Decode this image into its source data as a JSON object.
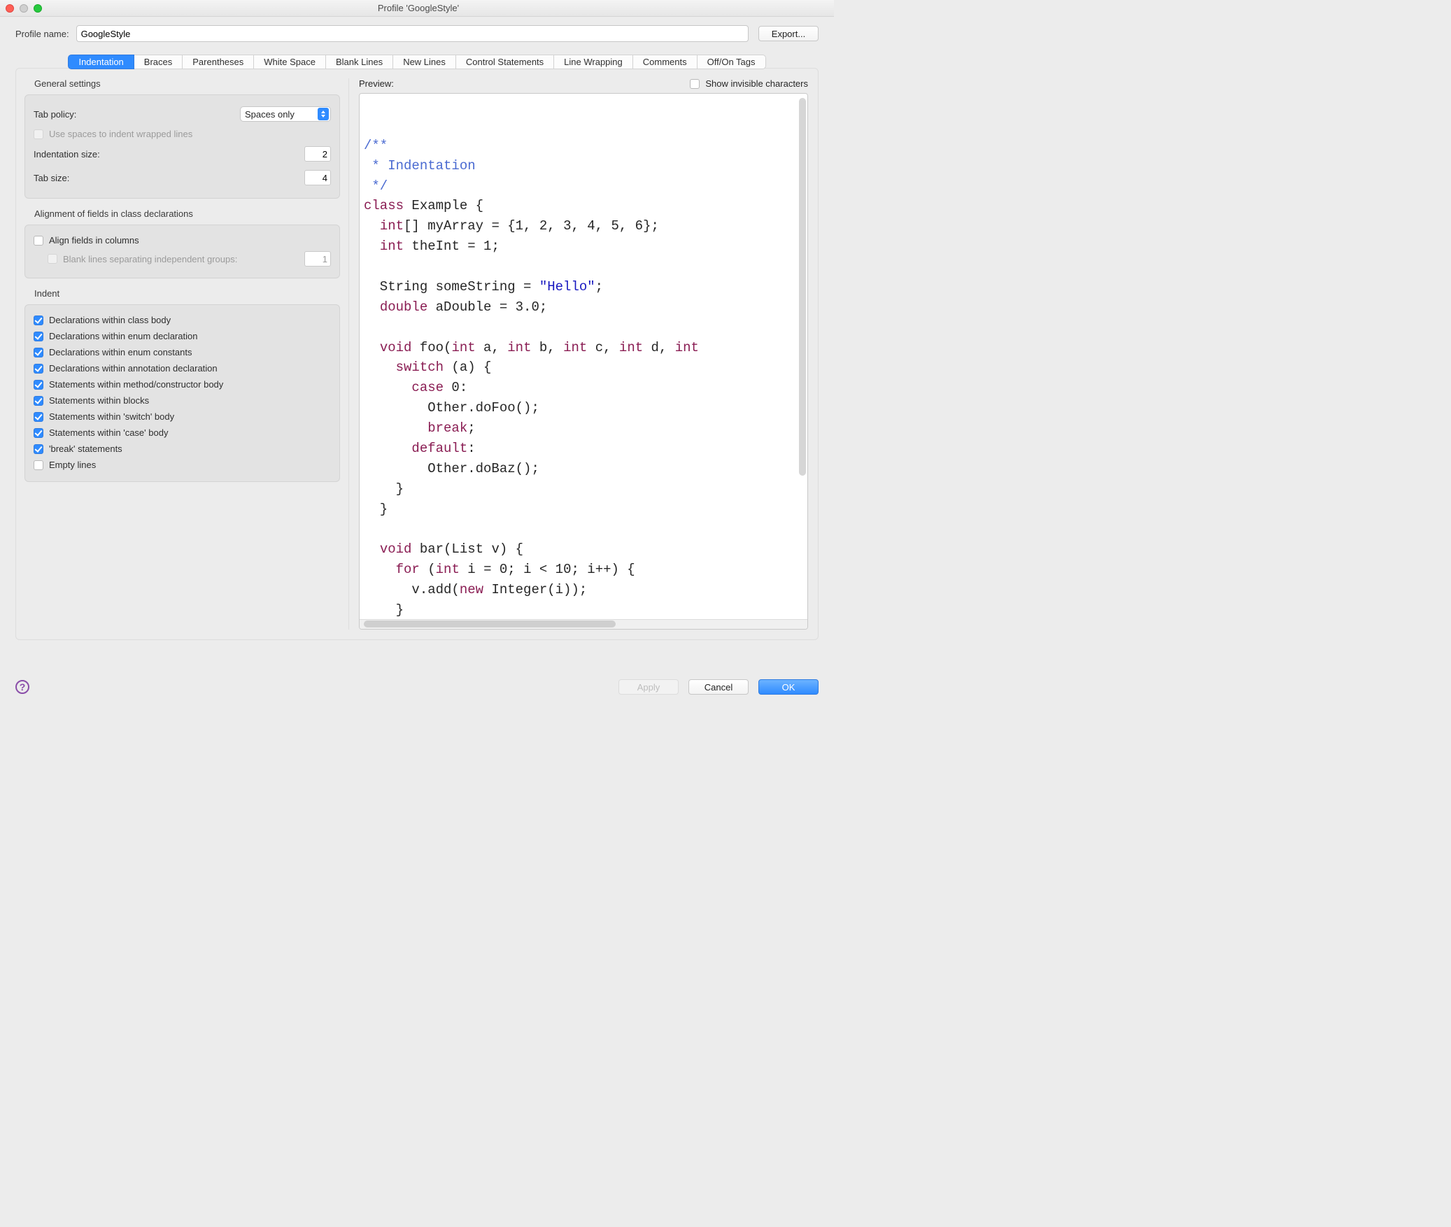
{
  "window": {
    "title": "Profile 'GoogleStyle'"
  },
  "profile": {
    "name_label": "Profile name:",
    "name_value": "GoogleStyle",
    "export_label": "Export..."
  },
  "tabs": [
    {
      "label": "Indentation",
      "active": true
    },
    {
      "label": "Braces"
    },
    {
      "label": "Parentheses"
    },
    {
      "label": "White Space"
    },
    {
      "label": "Blank Lines"
    },
    {
      "label": "New Lines"
    },
    {
      "label": "Control Statements"
    },
    {
      "label": "Line Wrapping"
    },
    {
      "label": "Comments"
    },
    {
      "label": "Off/On Tags"
    }
  ],
  "general": {
    "title": "General settings",
    "tab_policy_label": "Tab policy:",
    "tab_policy_value": "Spaces only",
    "use_spaces_wrapped": {
      "checked": false,
      "disabled": true,
      "label": "Use spaces to indent wrapped lines"
    },
    "indent_size_label": "Indentation size:",
    "indent_size_value": "2",
    "tab_size_label": "Tab size:",
    "tab_size_value": "4"
  },
  "alignment": {
    "title": "Alignment of fields in class declarations",
    "align_fields": {
      "checked": false,
      "label": "Align fields in columns"
    },
    "blank_lines": {
      "checked": false,
      "disabled": true,
      "label": "Blank lines separating independent groups:"
    },
    "blank_lines_value": "1"
  },
  "indent": {
    "title": "Indent",
    "items": [
      {
        "checked": true,
        "label": "Declarations within class body"
      },
      {
        "checked": true,
        "label": "Declarations within enum declaration"
      },
      {
        "checked": true,
        "label": "Declarations within enum constants"
      },
      {
        "checked": true,
        "label": "Declarations within annotation declaration"
      },
      {
        "checked": true,
        "label": "Statements within method/constructor body"
      },
      {
        "checked": true,
        "label": "Statements within blocks"
      },
      {
        "checked": true,
        "label": "Statements within 'switch' body"
      },
      {
        "checked": true,
        "label": "Statements within 'case' body"
      },
      {
        "checked": true,
        "label": "'break' statements"
      },
      {
        "checked": false,
        "label": "Empty lines"
      }
    ]
  },
  "preview": {
    "label": "Preview:",
    "show_invisible": {
      "checked": false,
      "label": "Show invisible characters"
    }
  },
  "footer": {
    "apply": "Apply",
    "cancel": "Cancel",
    "ok": "OK"
  },
  "code": {
    "c1": "/**",
    "c2": " * Indentation",
    "c3": " */",
    "k_class": "class",
    "sp": " ",
    "id_Example": "Example",
    "sp2": " ",
    "ob": "{",
    "l4a": "  ",
    "k_int1": "int",
    "l4b": "[] myArray = {1, 2, 3, 4, 5, 6};",
    "l5a": "  ",
    "k_int2": "int",
    "l5b": " theInt = 1;",
    "blank1": "",
    "l6a": "  String someString = ",
    "str1": "\"Hello\"",
    "l6b": ";",
    "l7a": "  ",
    "k_double": "double",
    "l7b": " aDouble = 3.0;",
    "blank2": "",
    "l8a": "  ",
    "k_void1": "void",
    "l8b": " foo(",
    "k_int3": "int",
    "l8c": " a, ",
    "k_int4": "int",
    "l8d": " b, ",
    "k_int5": "int",
    "l8e": " c, ",
    "k_int6": "int",
    "l8f": " d, ",
    "k_int7": "int",
    "l9a": "    ",
    "k_switch": "switch",
    "l9b": " (a) {",
    "l10a": "      ",
    "k_case": "case",
    "l10b": " 0:",
    "l11": "        Other.doFoo();",
    "l12a": "        ",
    "k_break": "break",
    "l12b": ";",
    "l13a": "      ",
    "k_default": "default",
    "l13b": ":",
    "l14": "        Other.doBaz();",
    "l15": "    }",
    "l16": "  }",
    "blank3": "",
    "l17a": "  ",
    "k_void2": "void",
    "l17b": " bar(List v) {",
    "l18a": "    ",
    "k_for": "for",
    "l18b": " (",
    "k_int8": "int",
    "l18c": " i = 0; i < 10; i++) {",
    "l19a": "      v.add(",
    "k_new": "new",
    "l19b": " Integer(i));",
    "l20": "    }",
    "l21": "  }",
    "l22": "}"
  }
}
